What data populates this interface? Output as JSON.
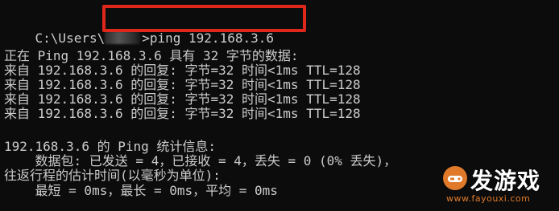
{
  "terminal": {
    "top_fragment": "",
    "prompt": {
      "path_prefix": "C:\\Users\\",
      "command": ">ping 192.168.3.6"
    },
    "output_lines": [
      "正在 Ping 192.168.3.6 具有 32 字节的数据:",
      "来自 192.168.3.6 的回复: 字节=32 时间<1ms TTL=128",
      "来自 192.168.3.6 的回复: 字节=32 时间<1ms TTL=128",
      "来自 192.168.3.6 的回复: 字节=32 时间<1ms TTL=128",
      "来自 192.168.3.6 的回复: 字节=32 时间<1ms TTL=128",
      "",
      "192.168.3.6 的 Ping 统计信息:",
      "    数据包: 已发送 = 4，已接收 = 4，丢失 = 0 (0% 丢失)，",
      "往返行程的估计时间(以毫秒为单位):",
      "    最短 = 0ms，最长 = 0ms，平均 = 0ms"
    ]
  },
  "annotation": {
    "highlight_color": "#e0271c"
  },
  "watermark": {
    "brand": "发游戏",
    "site": "www.fayouxi.com",
    "accent_color": "#e07a2a"
  }
}
